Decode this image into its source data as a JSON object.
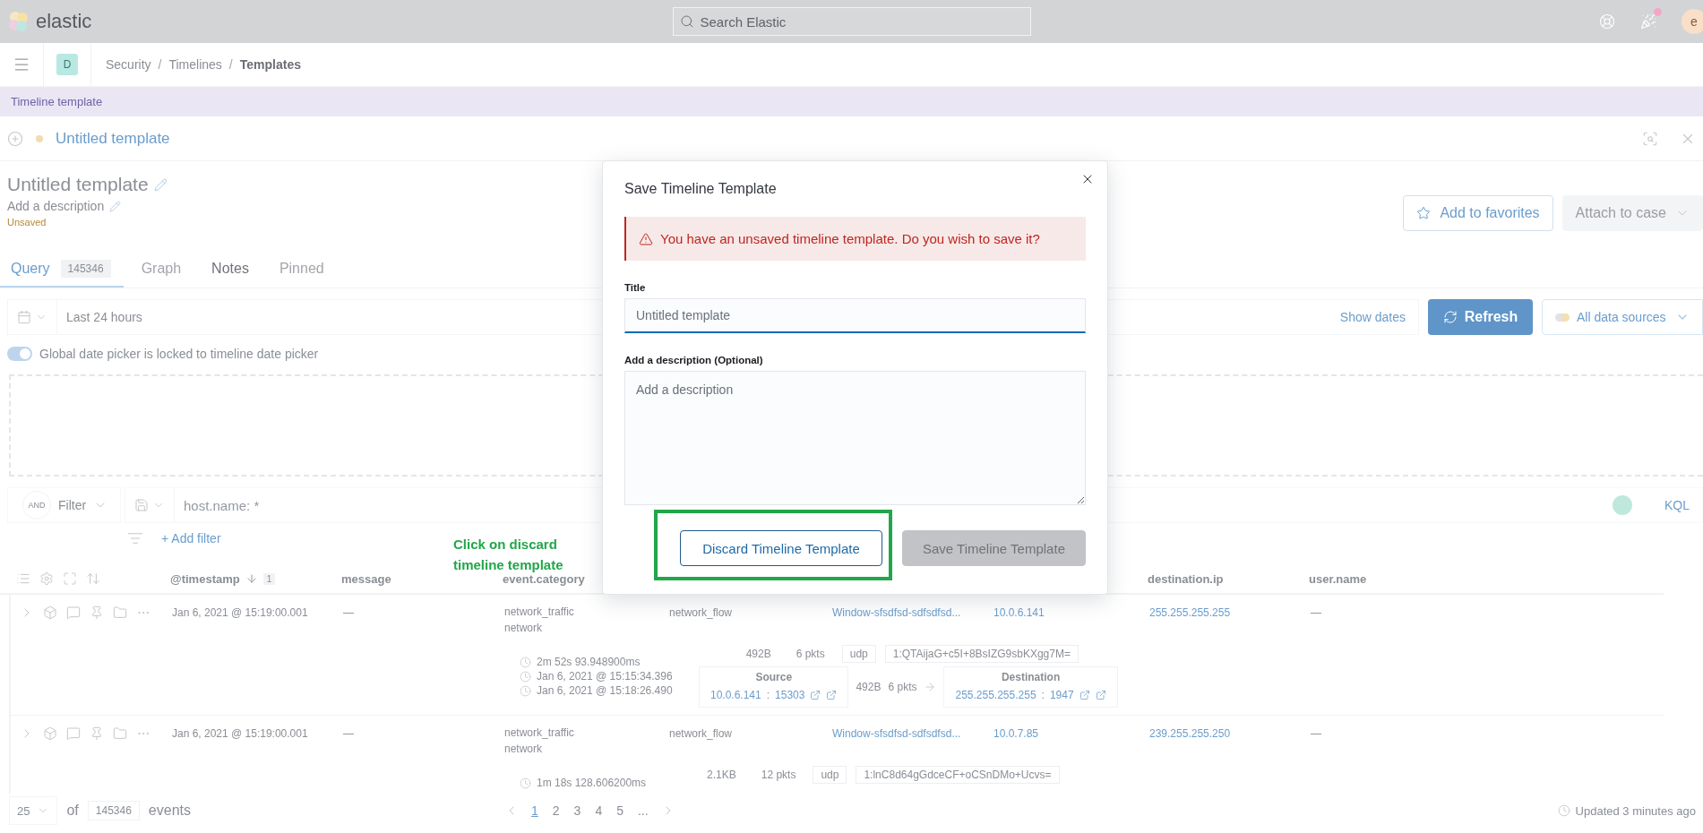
{
  "top_bar": {
    "logo": "elastic",
    "search": {
      "placeholder": "Search Elastic"
    },
    "avatar": "e",
    "news_unread": true
  },
  "breadcrumbs": {
    "space": "D",
    "separator": "/",
    "items": [
      {
        "label": "Security",
        "current": false
      },
      {
        "label": "Timelines",
        "current": false
      },
      {
        "label": "Templates",
        "current": true
      }
    ]
  },
  "banner": "Timeline template",
  "timeline_tab": {
    "title": "Untitled template"
  },
  "details": {
    "title": "Untitled template",
    "description": "Add a description",
    "status": "Unsaved",
    "actions": [
      {
        "label": "Add to favorites",
        "disabled": false,
        "kind": "favorite"
      },
      {
        "label": "Attach to case",
        "disabled": true,
        "kind": "menu"
      }
    ]
  },
  "tabs": [
    {
      "label": "Query",
      "count": "145346",
      "selected": true,
      "disabled": false
    },
    {
      "label": "Graph",
      "selected": false,
      "disabled": true
    },
    {
      "label": "Notes",
      "selected": false,
      "disabled": false
    },
    {
      "label": "Pinned",
      "selected": false,
      "disabled": true
    }
  ],
  "date_bar": {
    "range": "Last 24 hours",
    "show_dates": "Show dates",
    "refresh": "Refresh",
    "sources": "All data sources"
  },
  "lock_toggle": {
    "label": "Global date picker is locked to timeline date picker",
    "on": true
  },
  "query_bar": {
    "operator": "AND",
    "filter": "Filter",
    "placeholder": "host.name: *",
    "language": "KQL"
  },
  "add_filter": "+ Add filter",
  "table": {
    "columns_left": [
      {
        "label": "@timestamp",
        "sort_badge": "1"
      },
      {
        "label": "message"
      },
      {
        "label": "event.category"
      }
    ],
    "columns_right": [
      {
        "label": "destination.ip"
      },
      {
        "label": "user.name"
      }
    ],
    "rows": [
      {
        "cells": [
          {
            "kind": "text",
            "text": "Jan 6, 2021 @ 15:19:00.001"
          },
          {
            "kind": "text",
            "text": "—"
          },
          {
            "kind": "list",
            "items": [
              "network_traffic",
              "network"
            ]
          },
          {
            "kind": "text",
            "text": "network_flow"
          },
          {
            "kind": "link",
            "text": "Window-sfsdfsd-sdfsdfsd..."
          },
          {
            "kind": "link",
            "text": "10.0.6.141"
          },
          {
            "kind": "link",
            "text": "255.255.255.255"
          },
          {
            "kind": "text",
            "text": "—"
          }
        ],
        "durations": [
          "2m 52s 93.948900ms",
          "Jan 6, 2021 @ 15:15:34.396",
          "Jan 6, 2021 @ 15:18:26.490"
        ],
        "badges": [
          {
            "kind": "stat",
            "text": "492B"
          },
          {
            "kind": "stat",
            "text": "6 pkts"
          },
          {
            "kind": "tag",
            "text": "udp"
          },
          {
            "kind": "tag",
            "text": "1:QTAijaG+c5I+8BsIZG9sbKXgg7M="
          }
        ],
        "flow": {
          "separator": ":",
          "source": {
            "label": "Source",
            "ip": "10.0.6.141",
            "port": "15303"
          },
          "bytes": "492B",
          "packets": "6 pkts",
          "destination": {
            "label": "Destination",
            "ip": "255.255.255.255",
            "port": "1947"
          }
        }
      },
      {
        "cells": [
          {
            "kind": "text",
            "text": "Jan 6, 2021 @ 15:19:00.001"
          },
          {
            "kind": "text",
            "text": "—"
          },
          {
            "kind": "list",
            "items": [
              "network_traffic",
              "network"
            ]
          },
          {
            "kind": "text",
            "text": "network_flow"
          },
          {
            "kind": "link",
            "text": "Window-sfsdfsd-sdfsdfsd..."
          },
          {
            "kind": "link",
            "text": "10.0.7.85"
          },
          {
            "kind": "link",
            "text": "239.255.255.250"
          },
          {
            "kind": "text",
            "text": "—"
          }
        ],
        "durations": [
          "1m 18s 128.606200ms"
        ],
        "badges": [
          {
            "kind": "stat",
            "text": "2.1KB"
          },
          {
            "kind": "stat",
            "text": "12 pkts"
          },
          {
            "kind": "tag",
            "text": "udp"
          },
          {
            "kind": "tag",
            "text": "1:lnC8d64gGdceCF+oCSnDMo+Ucvs="
          }
        ]
      }
    ]
  },
  "footer": {
    "page_size": "25",
    "of": "of",
    "total": "145346",
    "unit": "events",
    "pages": [
      {
        "label": "1",
        "selected": true
      },
      {
        "label": "2",
        "selected": false
      },
      {
        "label": "3",
        "selected": false
      },
      {
        "label": "4",
        "selected": false
      },
      {
        "label": "5",
        "selected": false
      },
      {
        "label": "...",
        "selected": false
      }
    ],
    "updated": "Updated 3 minutes ago"
  },
  "modal": {
    "title": "Save Timeline Template",
    "callout": "You have an unsaved timeline template. Do you wish to save it?",
    "fields": [
      {
        "kind": "input",
        "label": "Title",
        "value": "Untitled template"
      },
      {
        "kind": "textarea",
        "label": "Add a description (Optional)",
        "placeholder": "Add a description"
      }
    ],
    "buttons": [
      {
        "kind": "secondary",
        "label": "Discard Timeline Template",
        "disabled": false,
        "highlighted": true
      },
      {
        "kind": "primary",
        "label": "Save Timeline Template",
        "disabled": true,
        "highlighted": false
      }
    ]
  },
  "annotation": "Click on discard timeline template"
}
